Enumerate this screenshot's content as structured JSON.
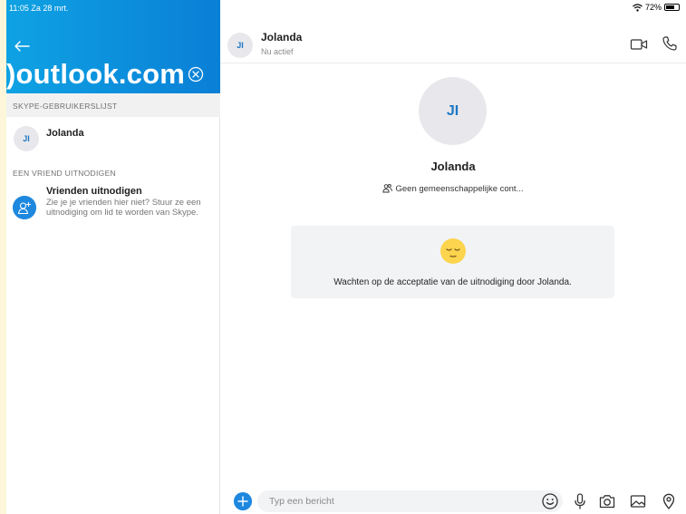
{
  "status_bar": {
    "time_date": "11:05  Za 28 mrt.",
    "battery": "72%",
    "battery_level": 0.72
  },
  "search_pane": {
    "query": "⁠)outlook.com",
    "sections": {
      "users_header": "SKYPE-GEBRUIKERSLIJST",
      "invite_header": "EEN VRIEND UITNODIGEN"
    },
    "contacts": [
      {
        "initials": "JI",
        "name": "Jolanda"
      }
    ],
    "invite": {
      "title": "Vrienden uitnodigen",
      "description": "Zie je je vrienden hier niet? Stuur ze een uitnodiging om lid te worden van Skype."
    }
  },
  "chat": {
    "header": {
      "initials": "JI",
      "name": "Jolanda",
      "status": "Nu actief"
    },
    "profile": {
      "initials": "JI",
      "name": "Jolanda",
      "mutual": "Geen gemeenschappelijke cont..."
    },
    "pending_message": "Wachten op de acceptatie van de uitnodiging door Jolanda.",
    "composer": {
      "placeholder": "Typ een bericht"
    }
  },
  "colors": {
    "accent": "#1e88df",
    "hero_start": "#0ea2e3",
    "hero_end": "#0a7fd6"
  }
}
